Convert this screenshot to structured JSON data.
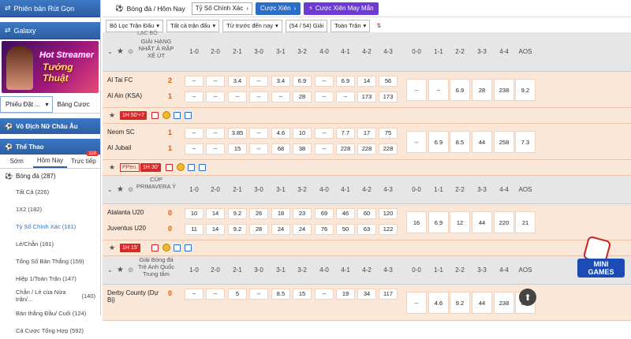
{
  "sidebar": {
    "banner1": "Phiên bản Rút Gọn",
    "banner2": "Galaxy",
    "promo_line1": "Hot Streamer",
    "promo_line2": "Tướng Thuật",
    "bet_tabs": [
      "Phiếu Đặt ...",
      "Bảng Cược"
    ],
    "head1": "Vô Địch Nữ Châu Âu",
    "head2": "Thể Thao",
    "time_tabs": [
      "Sớm",
      "Hôm Nay",
      "Trực tiếp"
    ],
    "live_badge": "118",
    "sport": "Bóng đá (287)",
    "items": [
      {
        "label": "Tất Cả (226)",
        "arrow": ""
      },
      {
        "label": "1X2 (182)",
        "arrow": ""
      },
      {
        "label": "Tỷ Số Chính Xác (161)",
        "arrow": ""
      },
      {
        "label": "Lẻ/Chẵn (181)",
        "arrow": ""
      },
      {
        "label": "Tổng Số Bàn Thắng (159)",
        "arrow": ""
      },
      {
        "label": "Hiệp 1/Toàn Trận (147)",
        "arrow": ""
      },
      {
        "label": "Chẵn / Lẻ của Nửa trận/...",
        "arrow": "(140)"
      },
      {
        "label": "Bàn thắng Đầu/ Cuối (124)",
        "arrow": ""
      },
      {
        "label": "Cá Cược Tổng Hợp (592)",
        "arrow": ""
      }
    ]
  },
  "topbar": {
    "title": "Bóng đá / Hôm Nay",
    "market": "Tỷ Số Chính Xác",
    "btn1": "Cược Xiên",
    "btn2": "Cược Xiên May Mắn"
  },
  "filters": [
    "Bộ Lọc Trận Đấu",
    "Tất cả trận đấu",
    "Từ trước đến nay",
    "(54 / 54) Giải",
    "Toàn Trận"
  ],
  "score_cols": [
    "1-0",
    "2-0",
    "2-1",
    "3-0",
    "3-1",
    "3-2",
    "4-0",
    "4-1",
    "4-2",
    "4-3",
    "0-0",
    "1-1",
    "2-2",
    "3-3",
    "4-4",
    "AOS"
  ],
  "leagues": [
    {
      "name": "GIẢI HẠNG NHẤT Ả RẬP XÊ ÚT",
      "matches": [
        {
          "home": "Al Tai FC",
          "away": "Al Ain (KSA)",
          "home_score": "2",
          "away_score": "1",
          "home_odds": [
            "--",
            "--",
            "3.4",
            "--",
            "3.4",
            "6.9",
            "--",
            "6.9",
            "14",
            "56"
          ],
          "away_odds": [
            "--",
            "--",
            "--",
            "--",
            "--",
            "28",
            "--",
            "--",
            "173",
            "173"
          ],
          "draw_odds": [
            "--",
            "--",
            "6.9",
            "28",
            "238",
            "9.2"
          ],
          "time": "1H 50'+7",
          "pen": ""
        },
        {
          "home": "Neom SC",
          "away": "Al Jubail",
          "home_score": "1",
          "away_score": "1",
          "home_odds": [
            "--",
            "--",
            "3.85",
            "--",
            "4.6",
            "10",
            "--",
            "7.7",
            "17",
            "75"
          ],
          "away_odds": [
            "--",
            "--",
            "15",
            "--",
            "68",
            "38",
            "--",
            "228",
            "228",
            "228"
          ],
          "draw_odds": [
            "--",
            "6.9",
            "8.5",
            "44",
            "258",
            "7.3"
          ],
          "time": "1H 30'",
          "pen": "PPen."
        }
      ]
    },
    {
      "name": "CÚP PRIMAVERA Ý",
      "matches": [
        {
          "home": "Atalanta U20",
          "away": "Juventus U20",
          "home_score": "0",
          "away_score": "0",
          "home_odds": [
            "10",
            "14",
            "9.2",
            "26",
            "18",
            "23",
            "69",
            "46",
            "60",
            "120"
          ],
          "away_odds": [
            "11",
            "14",
            "9.2",
            "28",
            "24",
            "24",
            "76",
            "50",
            "63",
            "122"
          ],
          "draw_odds": [
            "16",
            "6.9",
            "12",
            "44",
            "220",
            "21"
          ],
          "time": "1H 15'",
          "pen": ""
        }
      ]
    },
    {
      "name": "Giải Bóng đá Trẻ Anh Quốc Trung tâm",
      "matches": [
        {
          "home": "Derby County (Dự Bị)",
          "away": "",
          "home_score": "0",
          "away_score": "",
          "home_odds": [
            "--",
            "--",
            "5",
            "--",
            "8.5",
            "15",
            "--",
            "19",
            "34",
            "117"
          ],
          "away_odds": [],
          "draw_odds": [
            "--",
            "4.6",
            "9.2",
            "44",
            "238",
            "8.1"
          ],
          "time": "",
          "pen": ""
        }
      ]
    }
  ],
  "minigames_label": "MINI GAMES",
  "league_top_cut": "LẠC BỘ"
}
